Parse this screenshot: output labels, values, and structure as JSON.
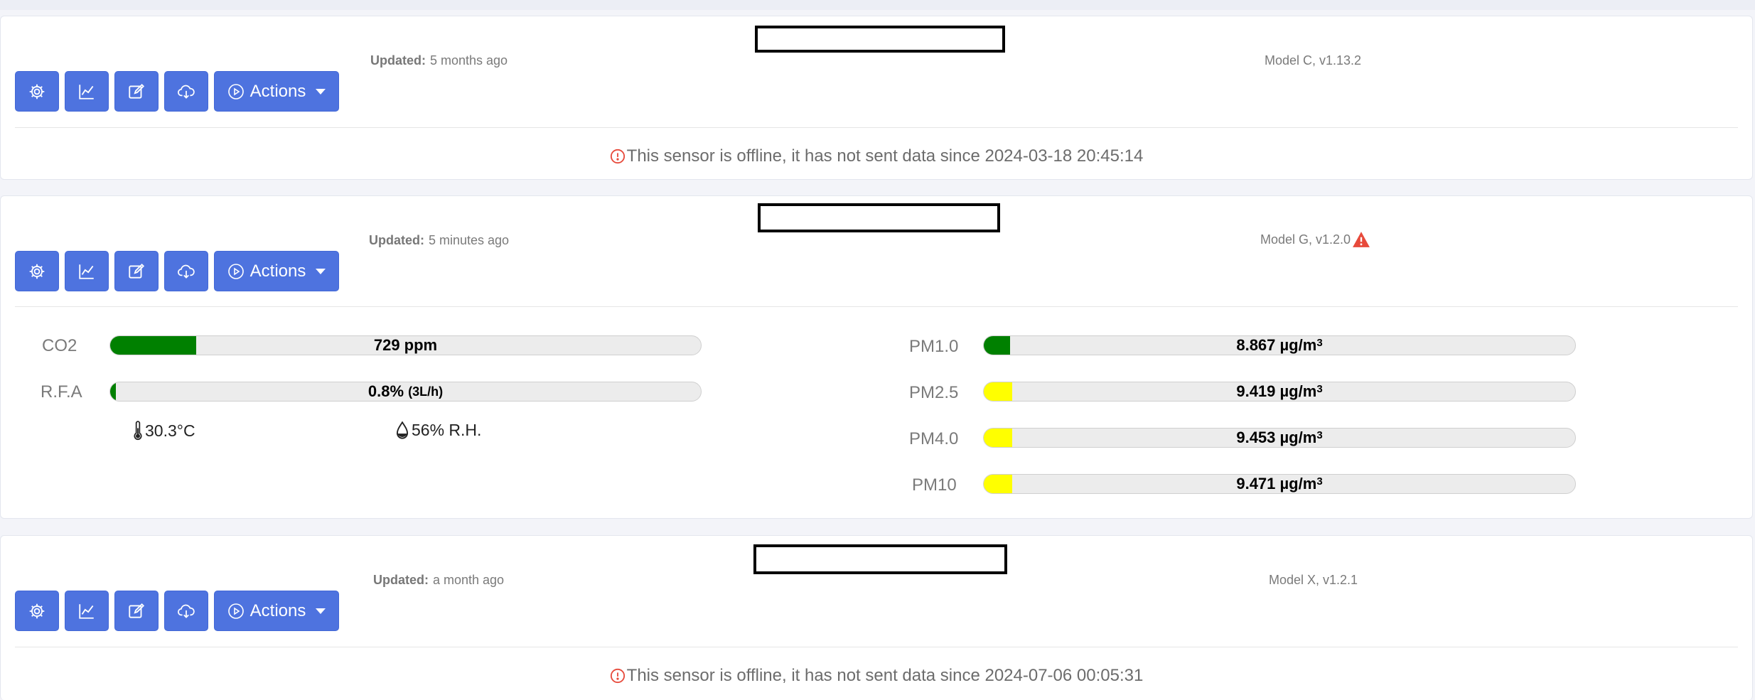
{
  "colors": {
    "primary": "#4e73df",
    "ok": "#008000",
    "moderate": "#ffff00",
    "offline_icon": "#e74a3b",
    "warning": "#e74a3b"
  },
  "toolbar": {
    "actions_label": "Actions",
    "icons": [
      "gear-icon",
      "chart-line-icon",
      "edit-icon",
      "cloud-download-icon",
      "play-circle-icon"
    ]
  },
  "sensors": [
    {
      "updated_label": "Updated:",
      "updated_value": "5 months ago",
      "model": "Model C, v1.13.2",
      "offline_message": "This sensor is offline, it has not sent data since 2024-03-18 20:45:14"
    },
    {
      "updated_label": "Updated:",
      "updated_value": "5 minutes ago",
      "model": "Model G, v1.2.0",
      "metrics_left": [
        {
          "label": "CO2",
          "value": "729 ppm",
          "fill_percent": 14.6,
          "color": "#008000"
        },
        {
          "label": "R.F.A",
          "value": "0.8%",
          "extra": "(3L/h)",
          "fill_percent": 0.8,
          "color": "#008000"
        }
      ],
      "temperature": "30.3°C",
      "humidity": "56% R.H.",
      "metrics_right": [
        {
          "label": "PM1.0",
          "value": "8.867 µg/m",
          "unit_sup": "3",
          "fill_percent": 4.5,
          "color": "#008000"
        },
        {
          "label": "PM2.5",
          "value": "9.419 µg/m",
          "unit_sup": "3",
          "fill_percent": 4.8,
          "color": "#ffff00"
        },
        {
          "label": "PM4.0",
          "value": "9.453 µg/m",
          "unit_sup": "3",
          "fill_percent": 4.8,
          "color": "#ffff00"
        },
        {
          "label": "PM10",
          "value": "9.471 µg/m",
          "unit_sup": "3",
          "fill_percent": 4.8,
          "color": "#ffff00"
        }
      ]
    },
    {
      "updated_label": "Updated:",
      "updated_value": "a month ago",
      "model": "Model X, v1.2.1",
      "offline_message": "This sensor is offline, it has not sent data since 2024-07-06 00:05:31"
    }
  ]
}
